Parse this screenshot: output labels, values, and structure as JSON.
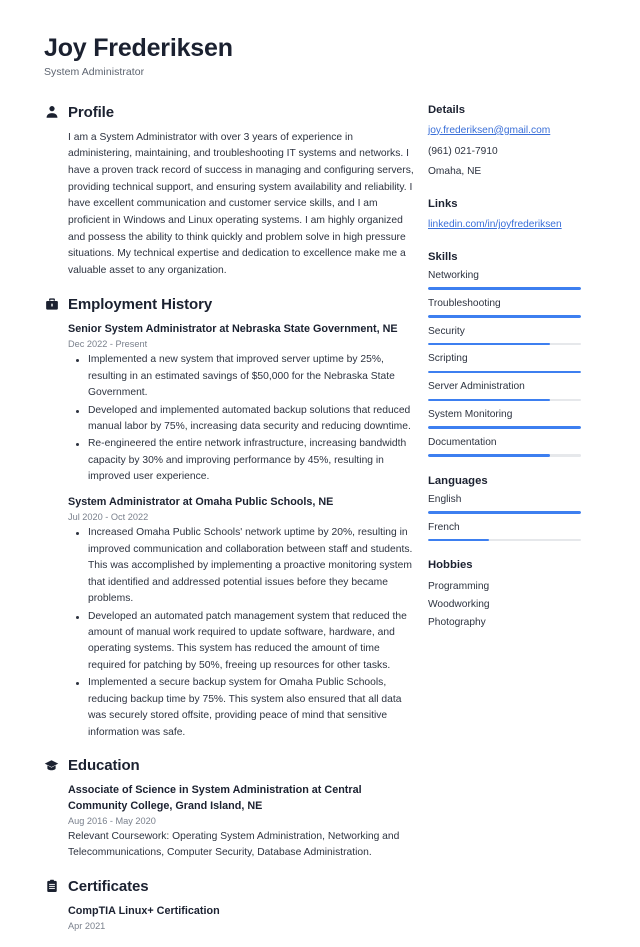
{
  "header": {
    "name": "Joy Frederiksen",
    "title": "System Administrator"
  },
  "profile": {
    "section_title": "Profile",
    "icon": "person-icon",
    "text": "I am a System Administrator with over 3 years of experience in administering, maintaining, and troubleshooting IT systems and networks. I have a proven track record of success in managing and configuring servers, providing technical support, and ensuring system availability and reliability. I have excellent communication and customer service skills, and I am proficient in Windows and Linux operating systems. I am highly organized and possess the ability to think quickly and problem solve in high pressure situations. My technical expertise and dedication to excellence make me a valuable asset to any organization."
  },
  "employment": {
    "section_title": "Employment History",
    "icon": "briefcase-icon",
    "entries": [
      {
        "title": "Senior System Administrator at Nebraska State Government, NE",
        "date": "Dec 2022 - Present",
        "bullets": [
          "Implemented a new system that improved server uptime by 25%, resulting in an estimated savings of $50,000 for the Nebraska State Government.",
          "Developed and implemented automated backup solutions that reduced manual labor by 75%, increasing data security and reducing downtime.",
          "Re-engineered the entire network infrastructure, increasing bandwidth capacity by 30% and improving performance by 45%, resulting in improved user experience."
        ]
      },
      {
        "title": "System Administrator at Omaha Public Schools, NE",
        "date": "Jul 2020 - Oct 2022",
        "bullets": [
          "Increased Omaha Public Schools' network uptime by 20%, resulting in improved communication and collaboration between staff and students. This was accomplished by implementing a proactive monitoring system that identified and addressed potential issues before they became problems.",
          "Developed an automated patch management system that reduced the amount of manual work required to update software, hardware, and operating systems. This system has reduced the amount of time required for patching by 50%, freeing up resources for other tasks.",
          "Implemented a secure backup system for Omaha Public Schools, reducing backup time by 75%. This system also ensured that all data was securely stored offsite, providing peace of mind that sensitive information was safe."
        ]
      }
    ]
  },
  "education": {
    "section_title": "Education",
    "icon": "graduation-cap-icon",
    "entries": [
      {
        "title": "Associate of Science in System Administration at Central Community College, Grand Island, NE",
        "date": "Aug 2016 - May 2020",
        "description": "Relevant Coursework: Operating System Administration, Networking and Telecommunications, Computer Security, Database Administration."
      }
    ]
  },
  "certificates": {
    "section_title": "Certificates",
    "icon": "clipboard-icon",
    "entries": [
      {
        "title": "CompTIA Linux+ Certification",
        "date": "Apr 2021"
      }
    ]
  },
  "details": {
    "title": "Details",
    "email": "joy.frederiksen@gmail.com",
    "phone": "(961) 021-7910",
    "location": "Omaha, NE"
  },
  "links": {
    "title": "Links",
    "items": [
      {
        "label": "linkedin.com/in/joyfrederiksen"
      }
    ]
  },
  "skills": {
    "title": "Skills",
    "items": [
      {
        "label": "Networking",
        "level": 100
      },
      {
        "label": "Troubleshooting",
        "level": 100
      },
      {
        "label": "Security",
        "level": 80
      },
      {
        "label": "Scripting",
        "level": 100
      },
      {
        "label": "Server Administration",
        "level": 80
      },
      {
        "label": "System Monitoring",
        "level": 100
      },
      {
        "label": "Documentation",
        "level": 80
      }
    ]
  },
  "languages": {
    "title": "Languages",
    "items": [
      {
        "label": "English",
        "level": 100
      },
      {
        "label": "French",
        "level": 40
      }
    ]
  },
  "hobbies": {
    "title": "Hobbies",
    "items": [
      {
        "label": "Programming"
      },
      {
        "label": "Woodworking"
      },
      {
        "label": "Photography"
      }
    ]
  },
  "colors": {
    "accent": "#3d7ff0",
    "link": "#3a6fd8",
    "text": "#1b2130",
    "muted": "#7a818d",
    "track": "#e6e8eb"
  }
}
